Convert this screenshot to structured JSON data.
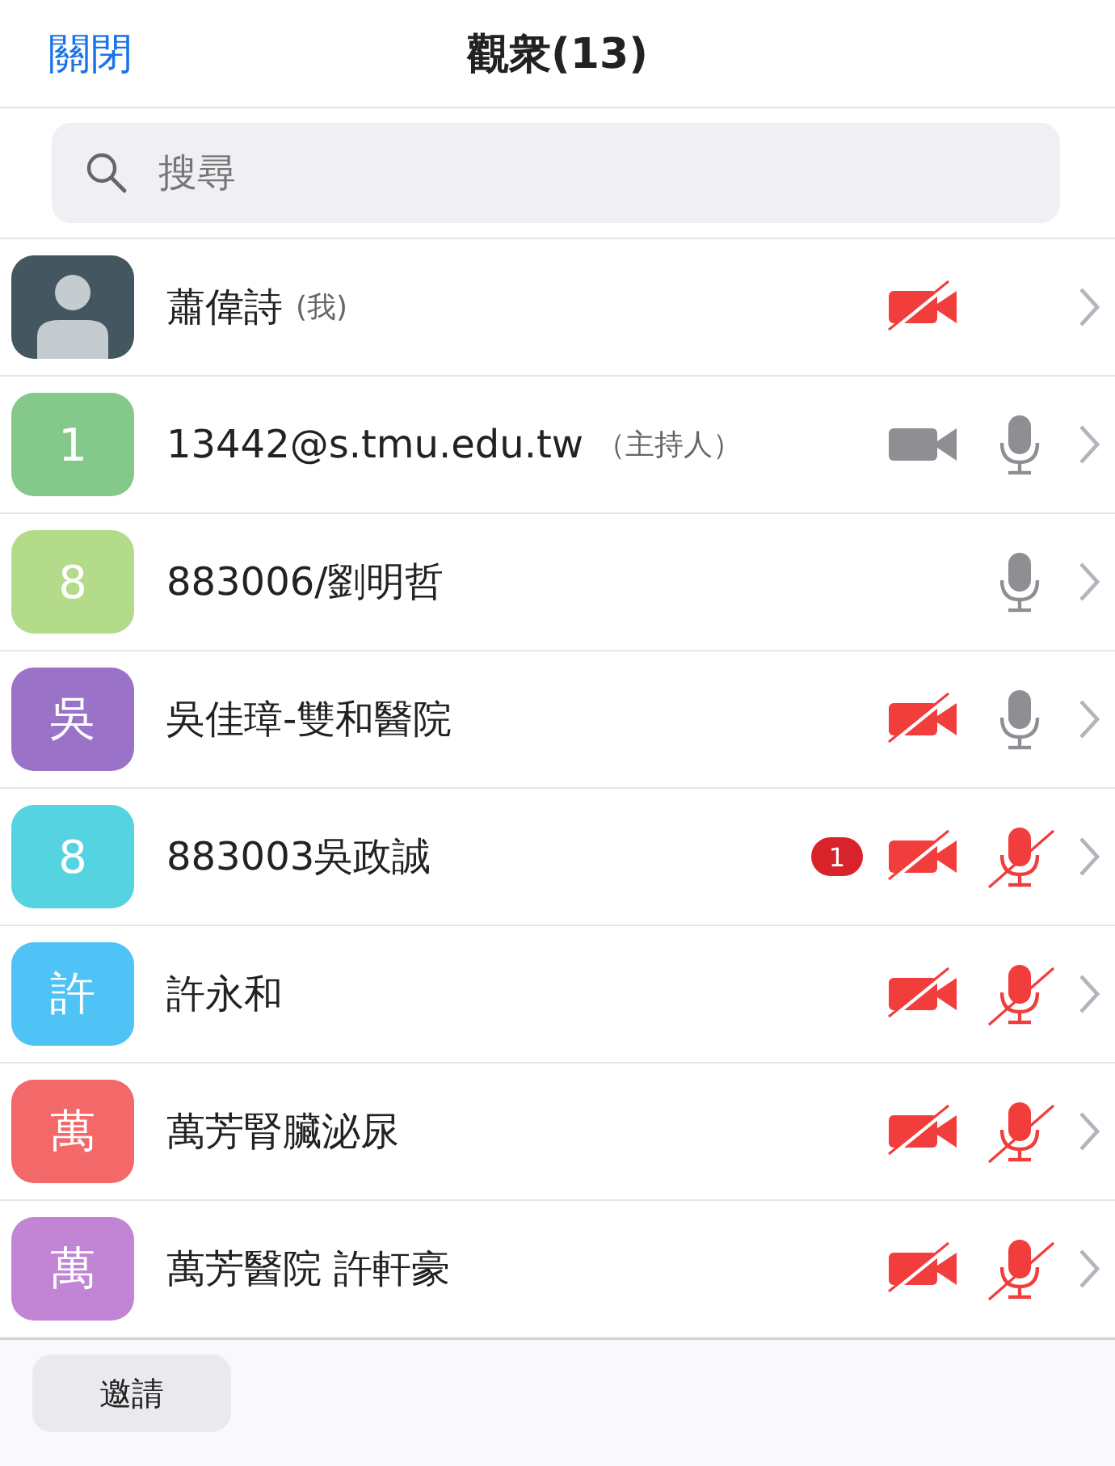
{
  "header": {
    "close": "關閉",
    "title": "觀衆(13)"
  },
  "search": {
    "placeholder": "搜尋"
  },
  "participants": [
    {
      "avatar": {
        "kind": "photo"
      },
      "name": "蕭偉詩",
      "tag": "(我)",
      "video_muted": true
    },
    {
      "avatar": {
        "kind": "letter",
        "initial": "1",
        "color": "#84c98a"
      },
      "name": "13442@s.tmu.edu.tw",
      "tag": "（主持人）",
      "video_muted": false,
      "audio_muted": false
    },
    {
      "avatar": {
        "kind": "letter",
        "initial": "8",
        "color": "#b3db8a"
      },
      "name": "883006/劉明哲",
      "audio_muted": false
    },
    {
      "avatar": {
        "kind": "letter",
        "initial": "吳",
        "color": "#9a72c8"
      },
      "name": "吳佳璋-雙和醫院",
      "video_muted": true,
      "audio_muted": false
    },
    {
      "avatar": {
        "kind": "letter",
        "initial": "8",
        "color": "#55d3e0"
      },
      "name": "883003吳政誠",
      "badge": "1",
      "video_muted": true,
      "audio_muted": true
    },
    {
      "avatar": {
        "kind": "letter",
        "initial": "許",
        "color": "#4fc3f5"
      },
      "name": "許永和",
      "video_muted": true,
      "audio_muted": true
    },
    {
      "avatar": {
        "kind": "letter",
        "initial": "萬",
        "color": "#f36868"
      },
      "name": "萬芳腎臟泌尿",
      "video_muted": true,
      "audio_muted": true
    },
    {
      "avatar": {
        "kind": "letter",
        "initial": "萬",
        "color": "#c285d6"
      },
      "name": "萬芳醫院 許軒豪",
      "video_muted": true,
      "audio_muted": true
    }
  ],
  "footer": {
    "invite": "邀請"
  }
}
